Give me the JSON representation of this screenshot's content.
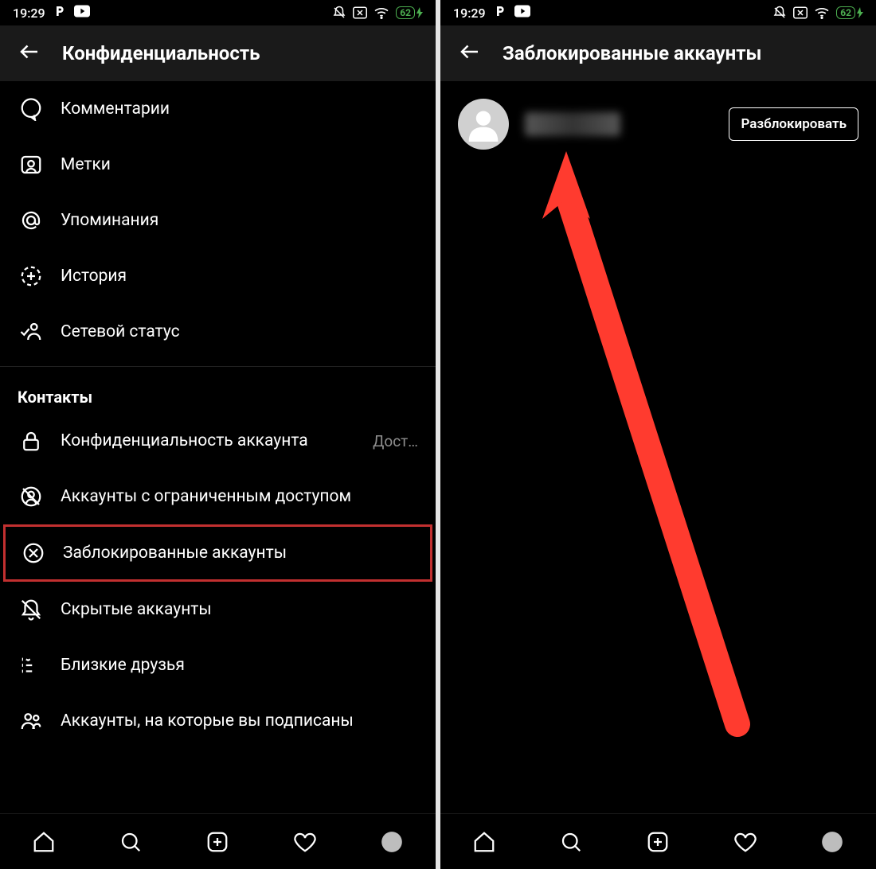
{
  "status": {
    "time": "19:29",
    "battery": "62"
  },
  "left": {
    "header": {
      "title": "Конфиденциальность"
    },
    "items_top": [
      {
        "id": "comments",
        "label": "Комментарии"
      },
      {
        "id": "tags",
        "label": "Метки"
      },
      {
        "id": "mentions",
        "label": "Упоминания"
      },
      {
        "id": "story",
        "label": "История"
      },
      {
        "id": "activity-status",
        "label": "Сетевой статус"
      }
    ],
    "section_contacts": "Контакты",
    "items_contacts": [
      {
        "id": "account-privacy",
        "label": "Конфиденциальность аккаунта",
        "trail": "Дост…"
      },
      {
        "id": "restricted",
        "label": "Аккаунты с ограниченным доступом"
      },
      {
        "id": "blocked",
        "label": "Заблокированные аккаунты",
        "highlight": true
      },
      {
        "id": "muted",
        "label": "Скрытые аккаунты"
      },
      {
        "id": "close-friends",
        "label": "Близкие друзья"
      },
      {
        "id": "following",
        "label": "Аккаунты, на которые вы подписаны"
      }
    ]
  },
  "right": {
    "header": {
      "title": "Заблокированные аккаунты"
    },
    "user": {
      "unblock_label": "Разблокировать"
    }
  }
}
